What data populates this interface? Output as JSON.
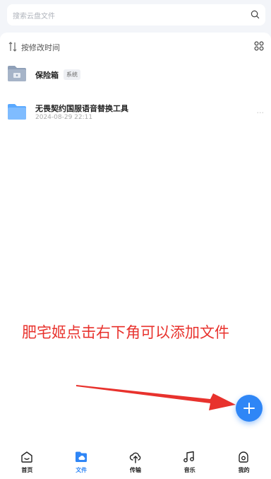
{
  "search": {
    "placeholder": "搜索云盘文件"
  },
  "toolbar": {
    "sort_label": "按修改时间"
  },
  "files": [
    {
      "name": "保险箱",
      "tag": "系统",
      "date": ""
    },
    {
      "name": "无畏契约国服语音替换工具",
      "tag": "",
      "date": "2024-08-29 22:11"
    }
  ],
  "annotation": {
    "text": "肥宅姬点击右下角可以添加文件"
  },
  "tabs": [
    {
      "label": "首页",
      "icon": "home-icon"
    },
    {
      "label": "文件",
      "icon": "folder-cloud-icon",
      "active": true
    },
    {
      "label": "传输",
      "icon": "cloud-transfer-icon"
    },
    {
      "label": "音乐",
      "icon": "music-note-icon"
    },
    {
      "label": "我的",
      "icon": "profile-icon"
    }
  ],
  "colors": {
    "accent": "#2f86f6",
    "annotation": "#e8322d",
    "background": "#f3f5f9"
  }
}
